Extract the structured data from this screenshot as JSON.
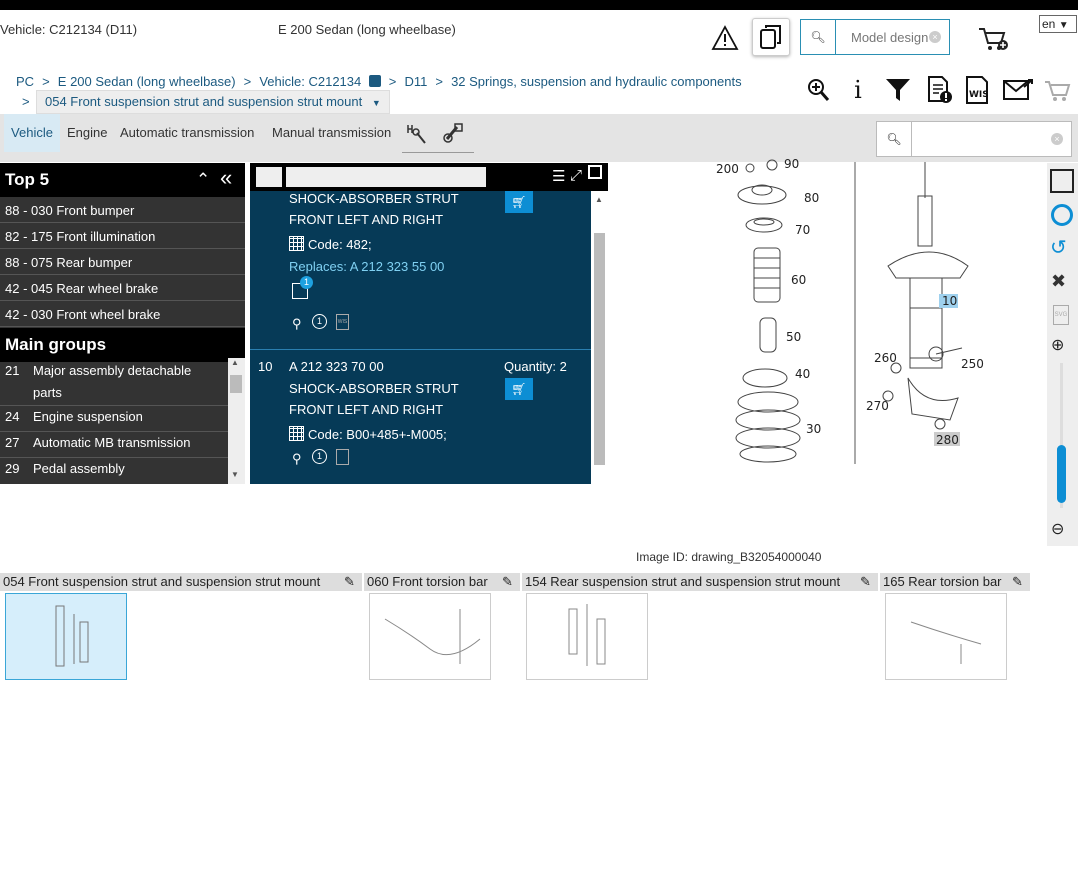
{
  "header": {
    "vehicle": "Vehicle: C212134 (D11)",
    "model": "E 200 Sedan (long wheelbase)",
    "search_placeholder": "Model design",
    "language": "en"
  },
  "breadcrumb": {
    "items": [
      "PC",
      "E 200 Sedan (long wheelbase)",
      "Vehicle: C212134",
      "D11",
      "32 Springs, suspension and hydraulic components"
    ],
    "current": "054 Front suspension strut and suspension strut mount"
  },
  "tabs": [
    "Vehicle",
    "Engine",
    "Automatic transmission",
    "Manual transmission"
  ],
  "left": {
    "top5_title": "Top 5",
    "top5": [
      "88 - 030 Front bumper",
      "82 - 175 Front illumination",
      "88 - 075 Rear bumper",
      "42 - 045 Rear wheel brake",
      "42 - 030 Front wheel brake"
    ],
    "groups_title": "Main groups",
    "groups": [
      {
        "num": "21",
        "label": "Major assembly detachable parts"
      },
      {
        "num": "24",
        "label": "Engine suspension"
      },
      {
        "num": "27",
        "label": "Automatic MB transmission"
      },
      {
        "num": "29",
        "label": "Pedal assembly"
      }
    ]
  },
  "parts": [
    {
      "desc1": "SHOCK-ABSORBER STRUT",
      "desc2": "FRONT LEFT AND RIGHT",
      "code": "Code: 482;",
      "replaces": "Replaces: A 212 323 55 00",
      "badge": "1"
    },
    {
      "pos": "10",
      "number": "A 212 323 70 00",
      "quantity": "Quantity: 2",
      "desc1": "SHOCK-ABSORBER STRUT",
      "desc2": "FRONT LEFT AND RIGHT",
      "code": "Code: B00+485+-M005;"
    }
  ],
  "drawing": {
    "labels": [
      "200",
      "90",
      "80",
      "70",
      "60",
      "50",
      "40",
      "30",
      "10",
      "260",
      "250",
      "270",
      "280"
    ],
    "image_id": "Image ID: drawing_B32054000040"
  },
  "thumbnails": [
    {
      "label": "054 Front suspension strut and suspension strut mount"
    },
    {
      "label": "060 Front torsion bar"
    },
    {
      "label": "154 Rear suspension strut and suspension strut mount"
    },
    {
      "label": "165 Rear torsion bar"
    }
  ]
}
